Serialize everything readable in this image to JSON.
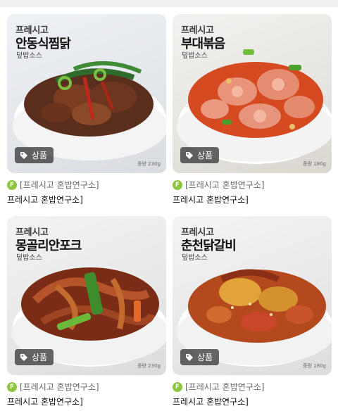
{
  "products": [
    {
      "brand": "프레시고",
      "menu": "안동식찜닭",
      "sub": "덮밥소스",
      "tag": "상품",
      "weight": "중량 230g",
      "seller_badge": "F",
      "seller": "[프레시고 혼밥연구소]",
      "title": "프레시고 혼밥연구소]"
    },
    {
      "brand": "프레시고",
      "menu": "부대볶음",
      "sub": "덮밥소스",
      "tag": "상품",
      "weight": "중량 180g",
      "seller_badge": "F",
      "seller": "[프레시고 혼밥연구소]",
      "title": "프레시고 혼밥연구소]"
    },
    {
      "brand": "프레시고",
      "menu": "몽골리안포크",
      "sub": "덮밥소스",
      "tag": "상품",
      "weight": "중량 230g",
      "seller_badge": "F",
      "seller": "[프레시고 혼밥연구소]",
      "title": "프레시고 혼밥연구소]"
    },
    {
      "brand": "프레시고",
      "menu": "춘천닭갈비",
      "sub": "덮밥소스",
      "tag": "상품",
      "weight": "중량 180g",
      "seller_badge": "F",
      "seller": "[프레시고 혼밥연구소]",
      "title": "프레시고 혼밥연구소]"
    }
  ],
  "colors": {
    "seller_badge": "#8cc63e",
    "tag_chip_bg": "#2d2d2d"
  },
  "icons": {
    "tag": "tag-icon"
  }
}
